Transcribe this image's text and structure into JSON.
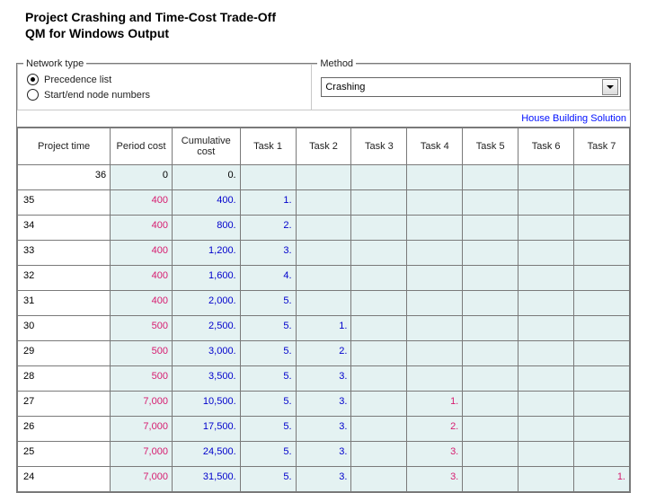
{
  "title_line1": "Project Crashing and Time-Cost Trade-Off",
  "title_line2": "QM for Windows Output",
  "panels": {
    "network_legend": "Network type",
    "radio1": "Precedence list",
    "radio2": "Start/end node numbers",
    "method_legend": "Method",
    "method_value": "Crashing"
  },
  "solution_label": "House Building Solution",
  "headers": {
    "h0": "Project time",
    "h1": "Period cost",
    "h2": "Cumulative cost",
    "h3": "Task 1",
    "h4": "Task 2",
    "h5": "Task 3",
    "h6": "Task 4",
    "h7": "Task 5",
    "h8": "Task 6",
    "h9": "Task 7"
  },
  "rows": [
    {
      "pt": "36",
      "pc": "0",
      "cc": "0.",
      "t1": "",
      "t2": "",
      "t3": "",
      "t4": "",
      "t5": "",
      "t6": "",
      "t7": ""
    },
    {
      "pt": "35",
      "pc": "400",
      "cc": "400.",
      "t1": "1.",
      "t2": "",
      "t3": "",
      "t4": "",
      "t5": "",
      "t6": "",
      "t7": ""
    },
    {
      "pt": "34",
      "pc": "400",
      "cc": "800.",
      "t1": "2.",
      "t2": "",
      "t3": "",
      "t4": "",
      "t5": "",
      "t6": "",
      "t7": ""
    },
    {
      "pt": "33",
      "pc": "400",
      "cc": "1,200.",
      "t1": "3.",
      "t2": "",
      "t3": "",
      "t4": "",
      "t5": "",
      "t6": "",
      "t7": ""
    },
    {
      "pt": "32",
      "pc": "400",
      "cc": "1,600.",
      "t1": "4.",
      "t2": "",
      "t3": "",
      "t4": "",
      "t5": "",
      "t6": "",
      "t7": ""
    },
    {
      "pt": "31",
      "pc": "400",
      "cc": "2,000.",
      "t1": "5.",
      "t2": "",
      "t3": "",
      "t4": "",
      "t5": "",
      "t6": "",
      "t7": ""
    },
    {
      "pt": "30",
      "pc": "500",
      "cc": "2,500.",
      "t1": "5.",
      "t2": "1.",
      "t3": "",
      "t4": "",
      "t5": "",
      "t6": "",
      "t7": ""
    },
    {
      "pt": "29",
      "pc": "500",
      "cc": "3,000.",
      "t1": "5.",
      "t2": "2.",
      "t3": "",
      "t4": "",
      "t5": "",
      "t6": "",
      "t7": ""
    },
    {
      "pt": "28",
      "pc": "500",
      "cc": "3,500.",
      "t1": "5.",
      "t2": "3.",
      "t3": "",
      "t4": "",
      "t5": "",
      "t6": "",
      "t7": ""
    },
    {
      "pt": "27",
      "pc": "7,000",
      "cc": "10,500.",
      "t1": "5.",
      "t2": "3.",
      "t3": "",
      "t4": "1.",
      "t5": "",
      "t6": "",
      "t7": ""
    },
    {
      "pt": "26",
      "pc": "7,000",
      "cc": "17,500.",
      "t1": "5.",
      "t2": "3.",
      "t3": "",
      "t4": "2.",
      "t5": "",
      "t6": "",
      "t7": ""
    },
    {
      "pt": "25",
      "pc": "7,000",
      "cc": "24,500.",
      "t1": "5.",
      "t2": "3.",
      "t3": "",
      "t4": "3.",
      "t5": "",
      "t6": "",
      "t7": ""
    },
    {
      "pt": "24",
      "pc": "7,000",
      "cc": "31,500.",
      "t1": "5.",
      "t2": "3.",
      "t3": "",
      "t4": "3.",
      "t5": "",
      "t6": "",
      "t7": "1."
    }
  ]
}
